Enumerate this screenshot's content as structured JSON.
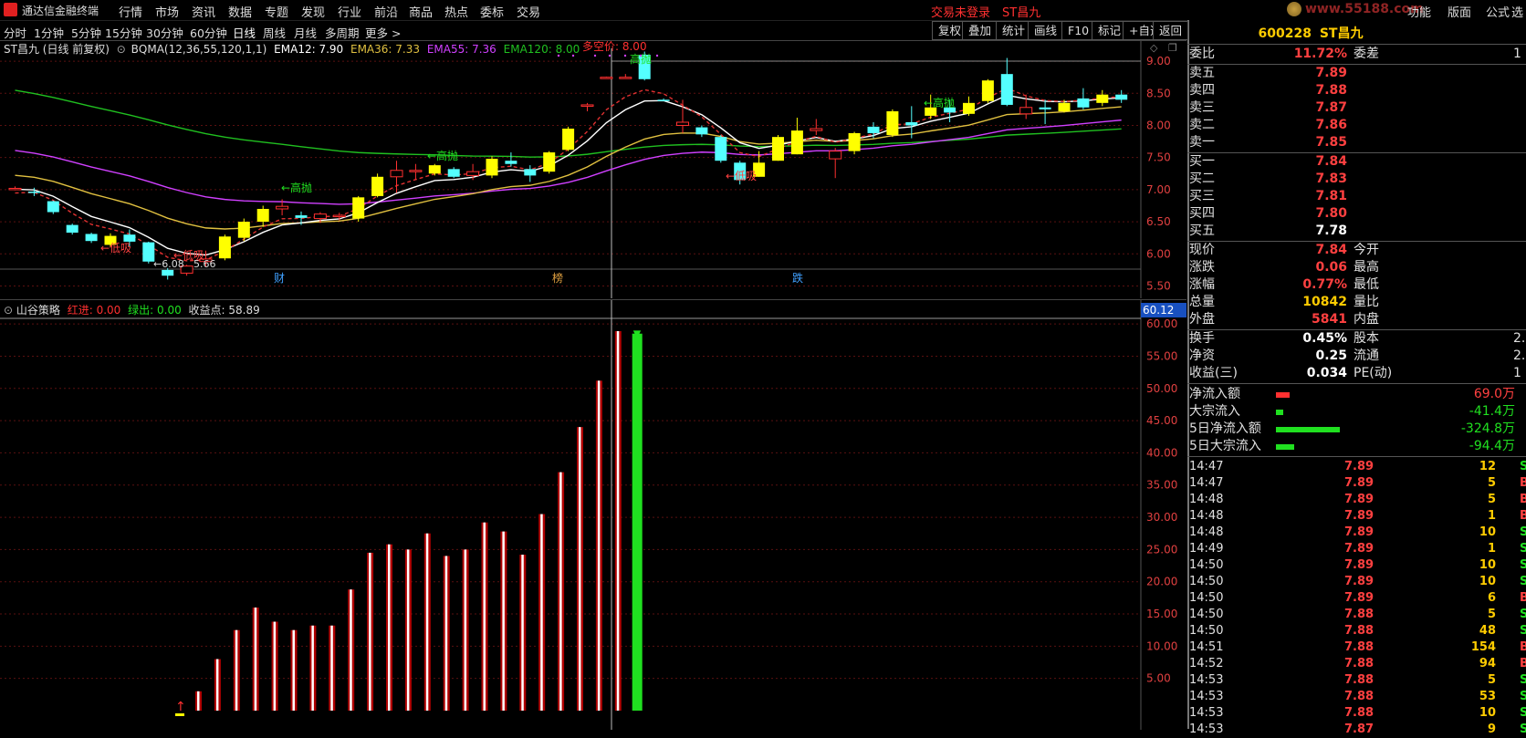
{
  "menubar": {
    "app_title": "通达信金融终端",
    "items": [
      "行情",
      "市场",
      "资讯",
      "数据",
      "专题",
      "发现",
      "行业",
      "前沿",
      "商品",
      "热点",
      "委标",
      "交易"
    ],
    "login_status": "交易未登录",
    "stock_name": "ST昌九",
    "right_links": [
      "功能",
      "版面",
      "公式",
      "选"
    ],
    "watermark": "www.55188.com"
  },
  "periods": [
    "分时",
    "1分钟",
    "5分钟",
    "15分钟",
    "30分钟",
    "60分钟",
    "日线",
    "周线",
    "月线",
    "多周期",
    "更多 >"
  ],
  "active_period": "日线",
  "tool_buttons": [
    "复权",
    "叠加",
    "统计",
    "画线",
    "F10",
    "标记",
    "+自选",
    "返回"
  ],
  "kchart": {
    "header": "ST昌九 (日线 前复权)",
    "indicator_name": "BQMA(12,36,55,120,1,1)",
    "ema12": "EMA12: 7.90",
    "ema36": "EMA36: 7.33",
    "ema55": "EMA55: 7.36",
    "ema120": "EMA120: 8.00",
    "price_axis": [
      "9.00",
      "8.50",
      "8.00",
      "7.50",
      "7.00",
      "6.50",
      "6.00",
      "5.50"
    ],
    "annotations": {
      "duokong": "多空价: 8.00",
      "low_label": "←6.08",
      "low_value": "5.66",
      "low1": "←低吸",
      "low2": "←低吸",
      "low3": "←低吸",
      "high1": "←高抛",
      "high2": "←高抛",
      "high3": "←高抛",
      "high4": "高抛",
      "bottom_labels": [
        "财",
        "榜",
        "跌"
      ]
    },
    "candles": [
      {
        "o": 7.02,
        "c": 7.02,
        "h": 7.05,
        "l": 6.99,
        "up": true
      },
      {
        "o": 6.97,
        "c": 6.97,
        "h": 7.03,
        "l": 6.9,
        "up": false
      },
      {
        "o": 6.82,
        "c": 6.65,
        "h": 6.83,
        "l": 6.62,
        "up": false
      },
      {
        "o": 6.45,
        "c": 6.33,
        "h": 6.47,
        "l": 6.3,
        "up": false
      },
      {
        "o": 6.31,
        "c": 6.2,
        "h": 6.33,
        "l": 6.17,
        "up": false
      },
      {
        "o": 6.14,
        "c": 6.28,
        "h": 6.32,
        "l": 6.1,
        "up": true
      },
      {
        "o": 6.3,
        "c": 6.19,
        "h": 6.38,
        "l": 6.11,
        "up": false
      },
      {
        "o": 6.18,
        "c": 5.88,
        "h": 6.19,
        "l": 5.85,
        "up": false
      },
      {
        "o": 5.75,
        "c": 5.66,
        "h": 5.78,
        "l": 5.6,
        "up": false
      },
      {
        "o": 5.7,
        "c": 5.81,
        "h": 5.83,
        "l": 5.66,
        "up": true
      },
      {
        "o": 5.88,
        "c": 5.92,
        "h": 6.05,
        "l": 5.8,
        "up": true
      },
      {
        "o": 5.93,
        "c": 6.27,
        "h": 6.3,
        "l": 5.9,
        "up": true
      },
      {
        "o": 6.25,
        "c": 6.5,
        "h": 6.55,
        "l": 6.2,
        "up": true
      },
      {
        "o": 6.5,
        "c": 6.7,
        "h": 6.75,
        "l": 6.42,
        "up": true
      },
      {
        "o": 6.7,
        "c": 6.74,
        "h": 6.85,
        "l": 6.6,
        "up": true
      },
      {
        "o": 6.6,
        "c": 6.56,
        "h": 6.66,
        "l": 6.45,
        "up": false
      },
      {
        "o": 6.55,
        "c": 6.62,
        "h": 6.65,
        "l": 6.48,
        "up": true
      },
      {
        "o": 6.58,
        "c": 6.6,
        "h": 6.64,
        "l": 6.52,
        "up": true
      },
      {
        "o": 6.55,
        "c": 6.88,
        "h": 6.9,
        "l": 6.5,
        "up": true
      },
      {
        "o": 6.9,
        "c": 7.2,
        "h": 7.25,
        "l": 6.88,
        "up": true
      },
      {
        "o": 7.2,
        "c": 7.3,
        "h": 7.45,
        "l": 6.95,
        "up": true
      },
      {
        "o": 7.28,
        "c": 7.3,
        "h": 7.4,
        "l": 7.15,
        "up": true
      },
      {
        "o": 7.25,
        "c": 7.38,
        "h": 7.4,
        "l": 7.22,
        "up": true
      },
      {
        "o": 7.32,
        "c": 7.2,
        "h": 7.35,
        "l": 7.18,
        "up": false
      },
      {
        "o": 7.22,
        "c": 7.28,
        "h": 7.4,
        "l": 7.15,
        "up": true
      },
      {
        "o": 7.22,
        "c": 7.48,
        "h": 7.52,
        "l": 7.18,
        "up": true
      },
      {
        "o": 7.45,
        "c": 7.4,
        "h": 7.58,
        "l": 7.36,
        "up": false
      },
      {
        "o": 7.32,
        "c": 7.22,
        "h": 7.38,
        "l": 7.12,
        "up": false
      },
      {
        "o": 7.28,
        "c": 7.58,
        "h": 7.6,
        "l": 7.25,
        "up": true
      },
      {
        "o": 7.62,
        "c": 7.95,
        "h": 7.98,
        "l": 7.6,
        "up": true
      },
      {
        "o": 8.32,
        "c": 8.32,
        "h": 8.35,
        "l": 8.22,
        "up": true
      },
      {
        "o": 8.75,
        "c": 8.75,
        "h": 8.76,
        "l": 8.75,
        "up": true
      },
      {
        "o": 8.75,
        "c": 8.75,
        "h": 8.8,
        "l": 8.75,
        "up": true
      },
      {
        "o": 9.1,
        "c": 8.72,
        "h": 9.15,
        "l": 8.7,
        "up": false
      },
      {
        "o": 8.4,
        "c": 8.4,
        "h": 8.42,
        "l": 8.4,
        "up": false
      },
      {
        "o": 8.0,
        "c": 8.05,
        "h": 8.4,
        "l": 7.88,
        "up": true
      },
      {
        "o": 7.97,
        "c": 7.86,
        "h": 8.0,
        "l": 7.82,
        "up": false
      },
      {
        "o": 7.82,
        "c": 7.45,
        "h": 7.85,
        "l": 7.42,
        "up": false
      },
      {
        "o": 7.42,
        "c": 7.15,
        "h": 7.45,
        "l": 7.08,
        "up": false
      },
      {
        "o": 7.2,
        "c": 7.42,
        "h": 7.6,
        "l": 7.2,
        "up": true
      },
      {
        "o": 7.45,
        "c": 7.82,
        "h": 7.85,
        "l": 7.45,
        "up": true
      },
      {
        "o": 7.55,
        "c": 7.92,
        "h": 8.12,
        "l": 7.55,
        "up": true
      },
      {
        "o": 7.92,
        "c": 7.95,
        "h": 8.1,
        "l": 7.85,
        "up": true
      },
      {
        "o": 7.48,
        "c": 7.6,
        "h": 7.65,
        "l": 7.18,
        "up": true
      },
      {
        "o": 7.6,
        "c": 7.88,
        "h": 7.9,
        "l": 7.55,
        "up": true
      },
      {
        "o": 7.88,
        "c": 7.98,
        "h": 8.05,
        "l": 7.8,
        "up": false
      },
      {
        "o": 7.85,
        "c": 8.22,
        "h": 8.25,
        "l": 7.82,
        "up": true
      },
      {
        "o": 8.0,
        "c": 8.05,
        "h": 8.3,
        "l": 7.8,
        "up": false
      },
      {
        "o": 8.15,
        "c": 8.28,
        "h": 8.48,
        "l": 8.1,
        "up": true
      },
      {
        "o": 8.2,
        "c": 8.28,
        "h": 8.4,
        "l": 8.05,
        "up": false
      },
      {
        "o": 8.18,
        "c": 8.35,
        "h": 8.45,
        "l": 8.15,
        "up": true
      },
      {
        "o": 8.38,
        "c": 8.7,
        "h": 8.72,
        "l": 8.35,
        "up": true
      },
      {
        "o": 8.32,
        "c": 8.8,
        "h": 9.05,
        "l": 8.3,
        "up": false
      },
      {
        "o": 8.18,
        "c": 8.28,
        "h": 8.48,
        "l": 8.1,
        "up": true
      },
      {
        "o": 8.25,
        "c": 8.28,
        "h": 8.4,
        "l": 8.02,
        "up": false
      },
      {
        "o": 8.22,
        "c": 8.35,
        "h": 8.4,
        "l": 8.2,
        "up": true
      },
      {
        "o": 8.28,
        "c": 8.42,
        "h": 8.58,
        "l": 8.25,
        "up": false
      },
      {
        "o": 8.35,
        "c": 8.48,
        "h": 8.55,
        "l": 8.3,
        "up": true
      },
      {
        "o": 8.4,
        "c": 8.48,
        "h": 8.55,
        "l": 8.35,
        "up": false
      }
    ]
  },
  "ichart": {
    "name": "山谷策略",
    "hongjin": "红进: 0.00",
    "luchu": "绿出: 0.00",
    "shouyi": "收益点: 58.89",
    "current_value": "60.12",
    "axis": [
      "60.00",
      "55.00",
      "50.00",
      "45.00",
      "40.00",
      "35.00",
      "30.00",
      "25.00",
      "20.00",
      "15.00",
      "10.00",
      "5.00"
    ],
    "bars": [
      3.0,
      8.0,
      12.5,
      16.0,
      13.8,
      12.5,
      13.2,
      13.2,
      18.8,
      24.5,
      25.8,
      25.0,
      27.5,
      24.0,
      25.0,
      29.2,
      27.8,
      24.2,
      30.5,
      37.0,
      44.0,
      51.2,
      58.89
    ],
    "green_bar": 58.5
  },
  "quote": {
    "code": "600228",
    "name": "ST昌九",
    "weibi_label": "委比",
    "weibi_value": "11.72%",
    "weicha_label": "委差",
    "weicha_value": "1",
    "asks": [
      {
        "label": "卖五",
        "price": "7.89"
      },
      {
        "label": "卖四",
        "price": "7.88"
      },
      {
        "label": "卖三",
        "price": "7.87"
      },
      {
        "label": "卖二",
        "price": "7.86"
      },
      {
        "label": "卖一",
        "price": "7.85"
      }
    ],
    "bids": [
      {
        "label": "买一",
        "price": "7.84",
        "cls": "red"
      },
      {
        "label": "买二",
        "price": "7.83",
        "cls": "red"
      },
      {
        "label": "买三",
        "price": "7.81",
        "cls": "red"
      },
      {
        "label": "买四",
        "price": "7.80",
        "cls": "red"
      },
      {
        "label": "买五",
        "price": "7.78",
        "cls": "white"
      }
    ],
    "stats": [
      {
        "l1": "现价",
        "v1": "7.84",
        "c1": "red",
        "l2": "今开"
      },
      {
        "l1": "涨跌",
        "v1": "0.06",
        "c1": "red",
        "l2": "最高"
      },
      {
        "l1": "涨幅",
        "v1": "0.77%",
        "c1": "red",
        "l2": "最低"
      },
      {
        "l1": "总量",
        "v1": "10842",
        "c1": "yellow",
        "l2": "量比"
      },
      {
        "l1": "外盘",
        "v1": "5841",
        "c1": "red",
        "l2": "内盘"
      }
    ],
    "stats2": [
      {
        "l1": "换手",
        "v1": "0.45%",
        "c1": "white",
        "l2": "股本",
        "v2": "2."
      },
      {
        "l1": "净资",
        "v1": "0.25",
        "c1": "white",
        "l2": "流通",
        "v2": "2."
      },
      {
        "l1": "收益(三)",
        "v1": "0.034",
        "c1": "white",
        "l2": "PE(动)",
        "v2": "1"
      }
    ],
    "flows": [
      {
        "label": "净流入额",
        "value": "69.0万",
        "cls": "red",
        "bar": 0.21,
        "barcolor": "#ff3030"
      },
      {
        "label": "大宗流入",
        "value": "-41.4万",
        "cls": "green",
        "bar": 0.12,
        "barcolor": "#20e020"
      },
      {
        "label": "5日净流入额",
        "value": "-324.8万",
        "cls": "green",
        "bar": 1.0,
        "barcolor": "#20e020"
      },
      {
        "label": "5日大宗流入",
        "value": "-94.4万",
        "cls": "green",
        "bar": 0.29,
        "barcolor": "#20e020"
      }
    ],
    "ticks": [
      {
        "t": "14:47",
        "p": "7.89",
        "v": "12",
        "s": "S",
        "pc": "red",
        "sc": "green"
      },
      {
        "t": "14:47",
        "p": "7.89",
        "v": "5",
        "s": "B",
        "pc": "red",
        "sc": "red"
      },
      {
        "t": "14:48",
        "p": "7.89",
        "v": "5",
        "s": "B",
        "pc": "red",
        "sc": "red"
      },
      {
        "t": "14:48",
        "p": "7.89",
        "v": "1",
        "s": "B",
        "pc": "red",
        "sc": "red"
      },
      {
        "t": "14:48",
        "p": "7.89",
        "v": "10",
        "s": "S",
        "pc": "red",
        "sc": "green"
      },
      {
        "t": "14:49",
        "p": "7.89",
        "v": "1",
        "s": "S",
        "pc": "red",
        "sc": "green"
      },
      {
        "t": "14:50",
        "p": "7.89",
        "v": "10",
        "s": "S",
        "pc": "red",
        "sc": "green"
      },
      {
        "t": "14:50",
        "p": "7.89",
        "v": "10",
        "s": "S",
        "pc": "red",
        "sc": "green"
      },
      {
        "t": "14:50",
        "p": "7.89",
        "v": "6",
        "s": "B",
        "pc": "red",
        "sc": "red"
      },
      {
        "t": "14:50",
        "p": "7.88",
        "v": "5",
        "s": "S",
        "pc": "red",
        "sc": "green"
      },
      {
        "t": "14:50",
        "p": "7.88",
        "v": "48",
        "s": "S",
        "pc": "red",
        "sc": "green"
      },
      {
        "t": "14:51",
        "p": "7.88",
        "v": "154",
        "s": "B",
        "pc": "red",
        "sc": "red"
      },
      {
        "t": "14:52",
        "p": "7.88",
        "v": "94",
        "s": "B",
        "pc": "red",
        "sc": "red"
      },
      {
        "t": "14:53",
        "p": "7.88",
        "v": "5",
        "s": "S",
        "pc": "red",
        "sc": "green"
      },
      {
        "t": "14:53",
        "p": "7.88",
        "v": "53",
        "s": "S",
        "pc": "red",
        "sc": "green"
      },
      {
        "t": "14:53",
        "p": "7.88",
        "v": "10",
        "s": "S",
        "pc": "red",
        "sc": "green"
      },
      {
        "t": "14:53",
        "p": "7.87",
        "v": "9",
        "s": "S",
        "pc": "red",
        "sc": "green"
      }
    ]
  },
  "colors": {
    "up": "#ff3030",
    "down": "#54ffff",
    "yang": "#ffff00",
    "ema12": "#ffffff",
    "ema36": "#e0c040",
    "ema55": "#d040ff",
    "ema120": "#20c020",
    "bar_red": "#b00000"
  }
}
